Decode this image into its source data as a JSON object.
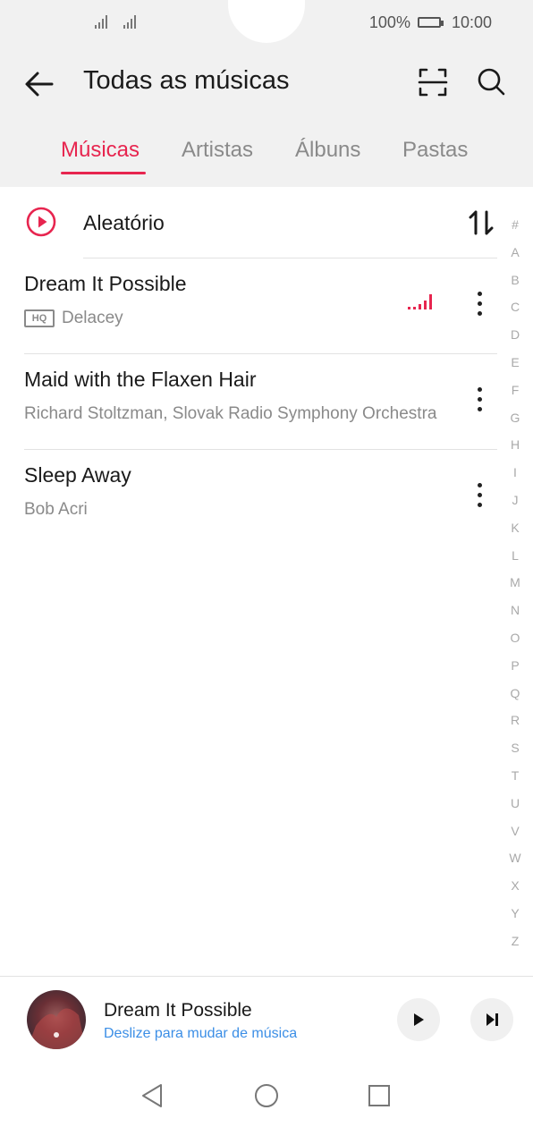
{
  "status": {
    "battery_text": "100%",
    "time": "10:00"
  },
  "header": {
    "title": "Todas as músicas"
  },
  "tabs": [
    {
      "label": "Músicas"
    },
    {
      "label": "Artistas"
    },
    {
      "label": "Álbuns"
    },
    {
      "label": "Pastas"
    }
  ],
  "shuffle": {
    "label": "Aleatório"
  },
  "songs": [
    {
      "title": "Dream It Possible",
      "artist": "Delacey",
      "badge": "HQ",
      "playing": true
    },
    {
      "title": "Maid with the Flaxen Hair",
      "artist": "Richard Stoltzman, Slovak Radio Symphony Orchestra"
    },
    {
      "title": "Sleep Away",
      "artist": "Bob Acri"
    }
  ],
  "alphabet": [
    "#",
    "A",
    "B",
    "C",
    "D",
    "E",
    "F",
    "G",
    "H",
    "I",
    "J",
    "K",
    "L",
    "M",
    "N",
    "O",
    "P",
    "Q",
    "R",
    "S",
    "T",
    "U",
    "V",
    "W",
    "X",
    "Y",
    "Z"
  ],
  "now_playing": {
    "title": "Dream It Possible",
    "subtitle": "Deslize para mudar de música"
  },
  "colors": {
    "accent": "#e7254f",
    "link": "#3b8ee6",
    "muted": "#8a8a8a"
  },
  "icons": {
    "back": "arrow-left-icon",
    "scan": "scan-icon",
    "search": "search-icon",
    "shuffle": "play-circle-icon",
    "sort": "sort-icon",
    "more": "more-vertical-icon",
    "play": "play-icon",
    "next": "skip-next-icon"
  }
}
